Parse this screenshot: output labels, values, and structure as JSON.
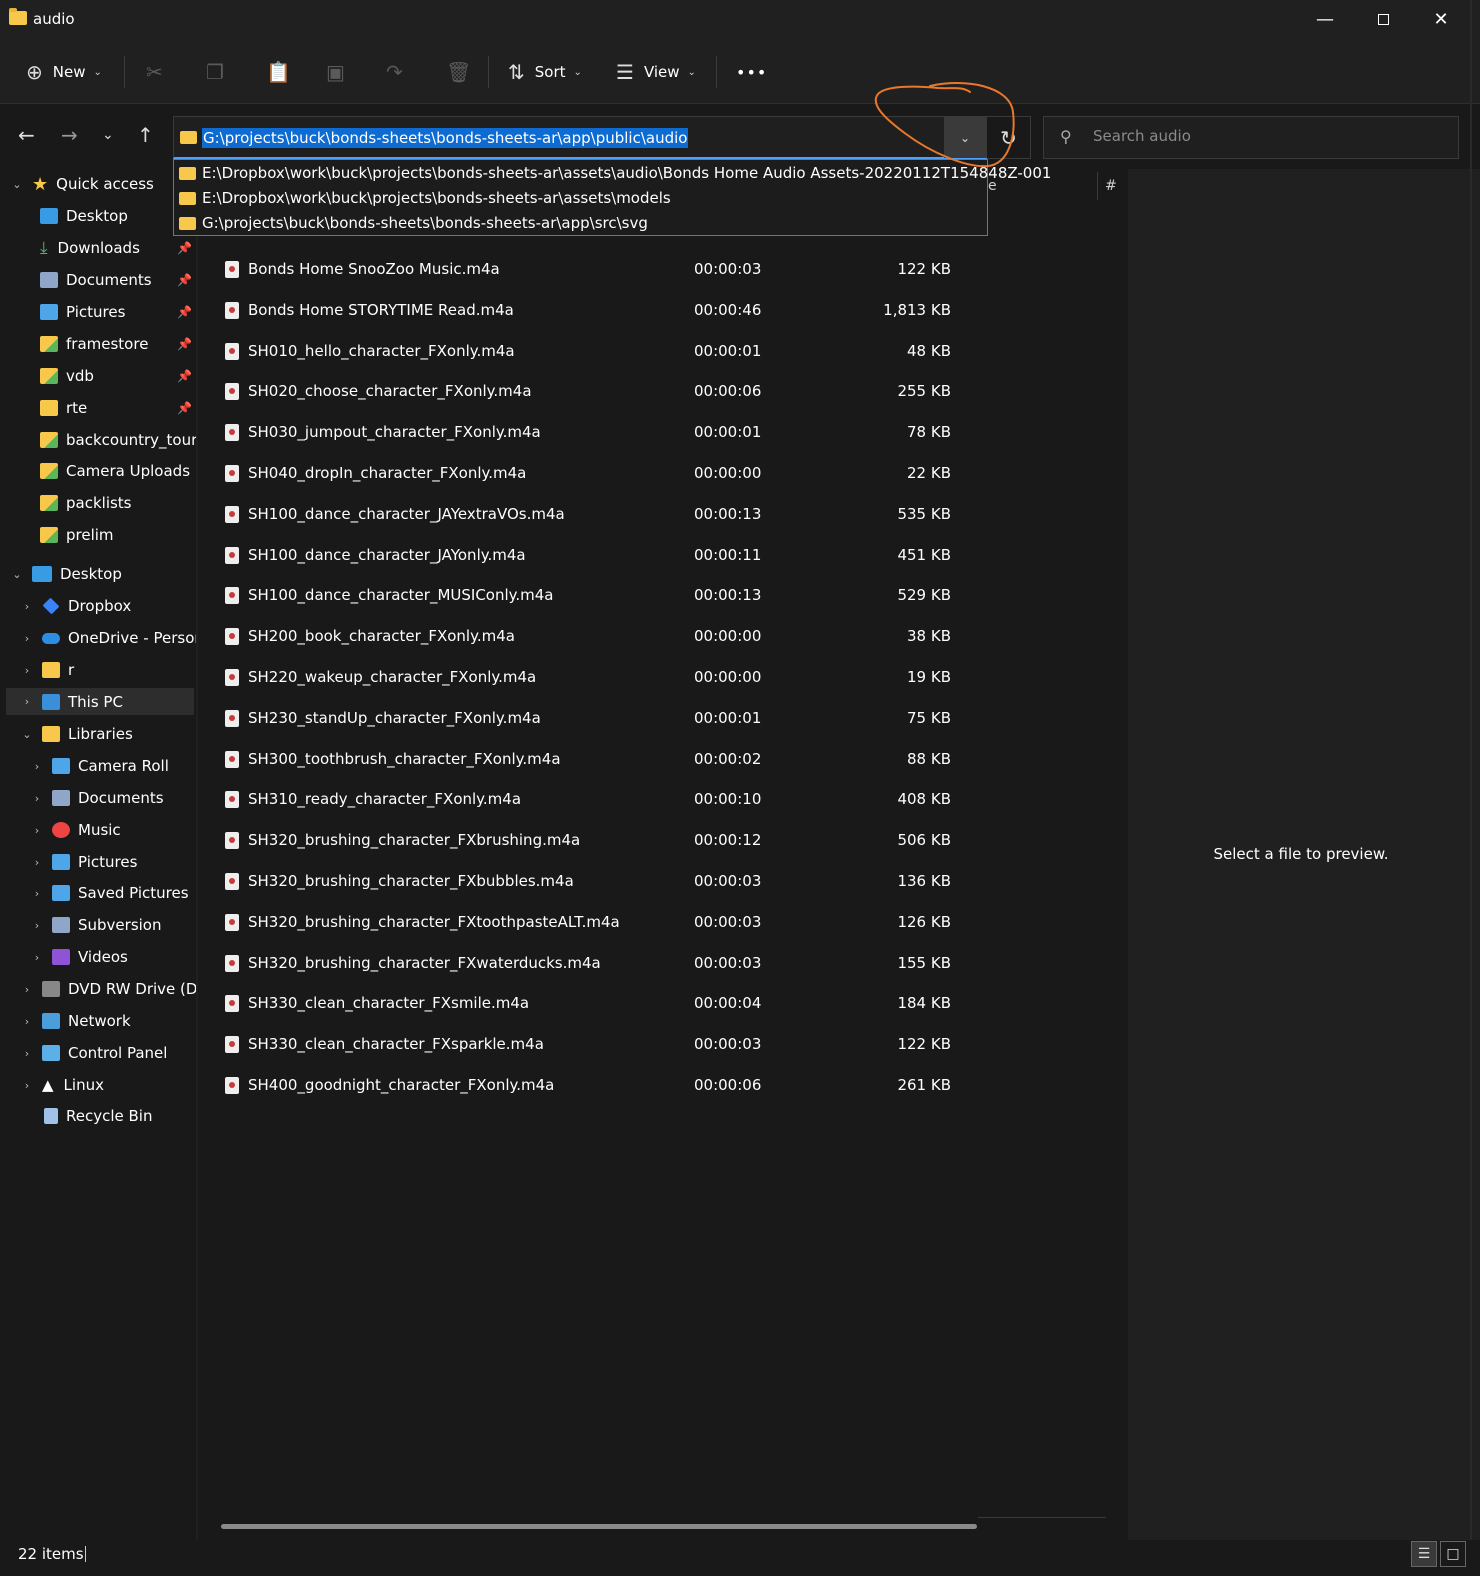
{
  "window": {
    "title": "audio"
  },
  "toolbar": {
    "new_label": "New",
    "sort_label": "Sort",
    "view_label": "View",
    "more_label": "•••"
  },
  "address": {
    "path": "G:\\projects\\buck\\bonds-sheets\\bonds-sheets-ar\\app\\public\\audio",
    "suggestions": [
      "E:\\Dropbox\\work\\buck\\projects\\bonds-sheets-ar\\assets\\audio\\Bonds Home Audio Assets-20220112T154848Z-001",
      "E:\\Dropbox\\work\\buck\\projects\\bonds-sheets-ar\\assets\\models",
      "G:\\projects\\buck\\bonds-sheets\\bonds-sheets-ar\\app\\src\\svg"
    ]
  },
  "search": {
    "placeholder": "Search audio"
  },
  "columns": {
    "partial_label": "e",
    "hash_label": "#"
  },
  "sidebar": {
    "items": [
      {
        "label": "Quick access",
        "icon": "star-icon"
      },
      {
        "label": "Desktop",
        "icon": "desktop-icon"
      },
      {
        "label": "Downloads",
        "icon": "download-icon"
      },
      {
        "label": "Documents",
        "icon": "documents-icon"
      },
      {
        "label": "Pictures",
        "icon": "pictures-icon"
      },
      {
        "label": "framestore",
        "icon": "folder-icon"
      },
      {
        "label": "vdb",
        "icon": "folder-icon"
      },
      {
        "label": "rte",
        "icon": "folder-icon"
      },
      {
        "label": "backcountry_touring",
        "icon": "folder-icon"
      },
      {
        "label": "Camera Uploads",
        "icon": "folder-icon"
      },
      {
        "label": "packlists",
        "icon": "folder-icon"
      },
      {
        "label": "prelim",
        "icon": "folder-icon"
      },
      {
        "label": "Desktop",
        "icon": "desktop-icon"
      },
      {
        "label": "Dropbox",
        "icon": "dropbox-icon"
      },
      {
        "label": "OneDrive - Personal",
        "icon": "onedrive-icon"
      },
      {
        "label": "r",
        "icon": "folder-icon"
      },
      {
        "label": "This PC",
        "icon": "pc-icon"
      },
      {
        "label": "Libraries",
        "icon": "folder-icon"
      },
      {
        "label": "Camera Roll",
        "icon": "pictures-icon"
      },
      {
        "label": "Documents",
        "icon": "documents-icon"
      },
      {
        "label": "Music",
        "icon": "music-icon"
      },
      {
        "label": "Pictures",
        "icon": "pictures-icon"
      },
      {
        "label": "Saved Pictures",
        "icon": "pictures-icon"
      },
      {
        "label": "Subversion",
        "icon": "subversion-icon"
      },
      {
        "label": "Videos",
        "icon": "video-icon"
      },
      {
        "label": "DVD RW Drive (D:)",
        "icon": "dvd-drive-icon"
      },
      {
        "label": "Network",
        "icon": "network-icon"
      },
      {
        "label": "Control Panel",
        "icon": "control-panel-icon"
      },
      {
        "label": "Linux",
        "icon": "linux-icon"
      },
      {
        "label": "Recycle Bin",
        "icon": "recycle-bin-icon"
      }
    ]
  },
  "files": [
    {
      "name": "Bonds Home SnooZoo Music.m4a",
      "duration": "00:00:03",
      "size": "122 KB"
    },
    {
      "name": "Bonds Home STORYTIME Read.m4a",
      "duration": "00:00:46",
      "size": "1,813 KB"
    },
    {
      "name": "SH010_hello_character_FXonly.m4a",
      "duration": "00:00:01",
      "size": "48 KB"
    },
    {
      "name": "SH020_choose_character_FXonly.m4a",
      "duration": "00:00:06",
      "size": "255 KB"
    },
    {
      "name": "SH030_jumpout_character_FXonly.m4a",
      "duration": "00:00:01",
      "size": "78 KB"
    },
    {
      "name": "SH040_dropIn_character_FXonly.m4a",
      "duration": "00:00:00",
      "size": "22 KB"
    },
    {
      "name": "SH100_dance_character_JAYextraVOs.m4a",
      "duration": "00:00:13",
      "size": "535 KB"
    },
    {
      "name": "SH100_dance_character_JAYonly.m4a",
      "duration": "00:00:11",
      "size": "451 KB"
    },
    {
      "name": "SH100_dance_character_MUSIConly.m4a",
      "duration": "00:00:13",
      "size": "529 KB"
    },
    {
      "name": "SH200_book_character_FXonly.m4a",
      "duration": "00:00:00",
      "size": "38 KB"
    },
    {
      "name": "SH220_wakeup_character_FXonly.m4a",
      "duration": "00:00:00",
      "size": "19 KB"
    },
    {
      "name": "SH230_standUp_character_FXonly.m4a",
      "duration": "00:00:01",
      "size": "75 KB"
    },
    {
      "name": "SH300_toothbrush_character_FXonly.m4a",
      "duration": "00:00:02",
      "size": "88 KB"
    },
    {
      "name": "SH310_ready_character_FXonly.m4a",
      "duration": "00:00:10",
      "size": "408 KB"
    },
    {
      "name": "SH320_brushing_character_FXbrushing.m4a",
      "duration": "00:00:12",
      "size": "506 KB"
    },
    {
      "name": "SH320_brushing_character_FXbubbles.m4a",
      "duration": "00:00:03",
      "size": "136 KB"
    },
    {
      "name": "SH320_brushing_character_FXtoothpasteALT.m4a",
      "duration": "00:00:03",
      "size": "126 KB"
    },
    {
      "name": "SH320_brushing_character_FXwaterducks.m4a",
      "duration": "00:00:03",
      "size": "155 KB"
    },
    {
      "name": "SH330_clean_character_FXsmile.m4a",
      "duration": "00:00:04",
      "size": "184 KB"
    },
    {
      "name": "SH330_clean_character_FXsparkle.m4a",
      "duration": "00:00:03",
      "size": "122 KB"
    },
    {
      "name": "SH400_goodnight_character_FXonly.m4a",
      "duration": "00:00:06",
      "size": "261 KB"
    }
  ],
  "preview": {
    "message": "Select a file to preview."
  },
  "status": {
    "item_count": "22 items"
  },
  "colors": {
    "accent": "#0d6bd1",
    "annotation": "#e8782a",
    "folder": "#f8c84b"
  }
}
